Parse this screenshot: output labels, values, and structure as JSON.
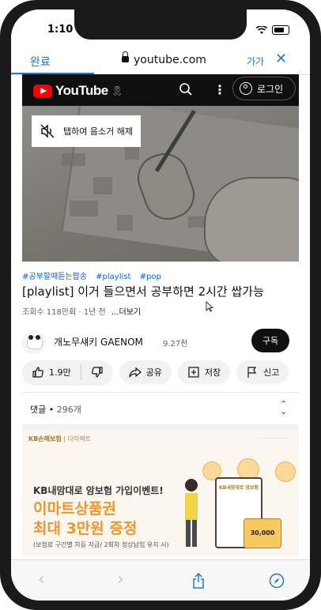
{
  "status_bar": {
    "time": "1:10"
  },
  "browser": {
    "done_label": "완료",
    "url": "youtube.com",
    "text_size_label": "가가",
    "close_label": "✕"
  },
  "youtube_header": {
    "logo_text": "YouTube",
    "login_label": "로그인"
  },
  "player": {
    "unmute_label": "탭하여 음소거 해제"
  },
  "video": {
    "hashtags": [
      "#공부할때듣는팝송",
      "#playlist",
      "#pop"
    ],
    "title": "[playlist] 이거 들으면서 공부하면 2시간 쌉가능",
    "views": "조회수 118만회",
    "age": "1년 전",
    "more_label": "...더보기"
  },
  "channel": {
    "name": "개노무섀키 GAENOM",
    "subscribers": "9.27천",
    "subscribe_label": "구독"
  },
  "actions": {
    "like_count": "1.9만",
    "share_label": "공유",
    "save_label": "저장",
    "report_label": "신고"
  },
  "comments": {
    "label": "댓글",
    "count": "296개"
  },
  "ad": {
    "brand": "KB손해보험",
    "brand_sub": "다이렉트",
    "headline": "KB내맘대로 암보험 가입이벤트!",
    "promo_line1": "이마트상품권",
    "promo_line2": "최대 3만원 증정",
    "condition": "(보험료 구간별 차등 지급/ 2회차 정상납입 유지 시)",
    "board_title": "KB내맘대로 암보험",
    "card_amount": "30,000"
  },
  "colors": {
    "ios_blue": "#1f78d1",
    "youtube_red": "#ff0000",
    "ad_orange": "#f0952a"
  }
}
